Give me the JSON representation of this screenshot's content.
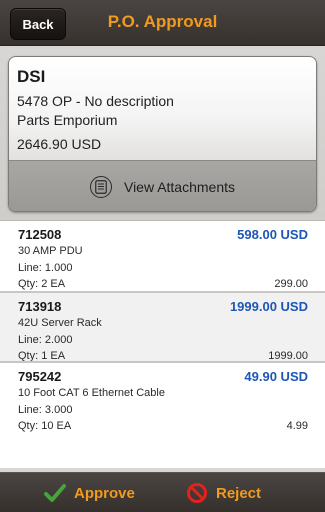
{
  "header": {
    "back_label": "Back",
    "title": "P.O. Approval"
  },
  "summary": {
    "vendor": "DSI",
    "po_line": "5478 OP - No description",
    "company": "Parts Emporium",
    "total": "2646.90 USD",
    "attachments_label": "View Attachments"
  },
  "items": [
    {
      "number": "712508",
      "price": "598.00 USD",
      "description": "30 AMP PDU",
      "line": "Line: 1.000",
      "qty": "Qty: 2 EA",
      "unit_price": "299.00"
    },
    {
      "number": "713918",
      "price": "1999.00 USD",
      "description": "42U Server Rack",
      "line": "Line: 2.000",
      "qty": "Qty: 1 EA",
      "unit_price": "1999.00"
    },
    {
      "number": "795242",
      "price": "49.90 USD",
      "description": "10 Foot CAT 6 Ethernet Cable",
      "line": "Line: 3.000",
      "qty": "Qty: 10 EA",
      "unit_price": "4.99"
    }
  ],
  "footer": {
    "approve_label": "Approve",
    "reject_label": "Reject"
  },
  "colors": {
    "accent": "#f09a1e",
    "price": "#1e56b5",
    "approve_icon": "#49a23a",
    "reject_icon": "#e3221b"
  },
  "icons": {
    "attachments": "document-list-icon",
    "approve": "checkmark-icon",
    "reject": "prohibited-icon"
  }
}
